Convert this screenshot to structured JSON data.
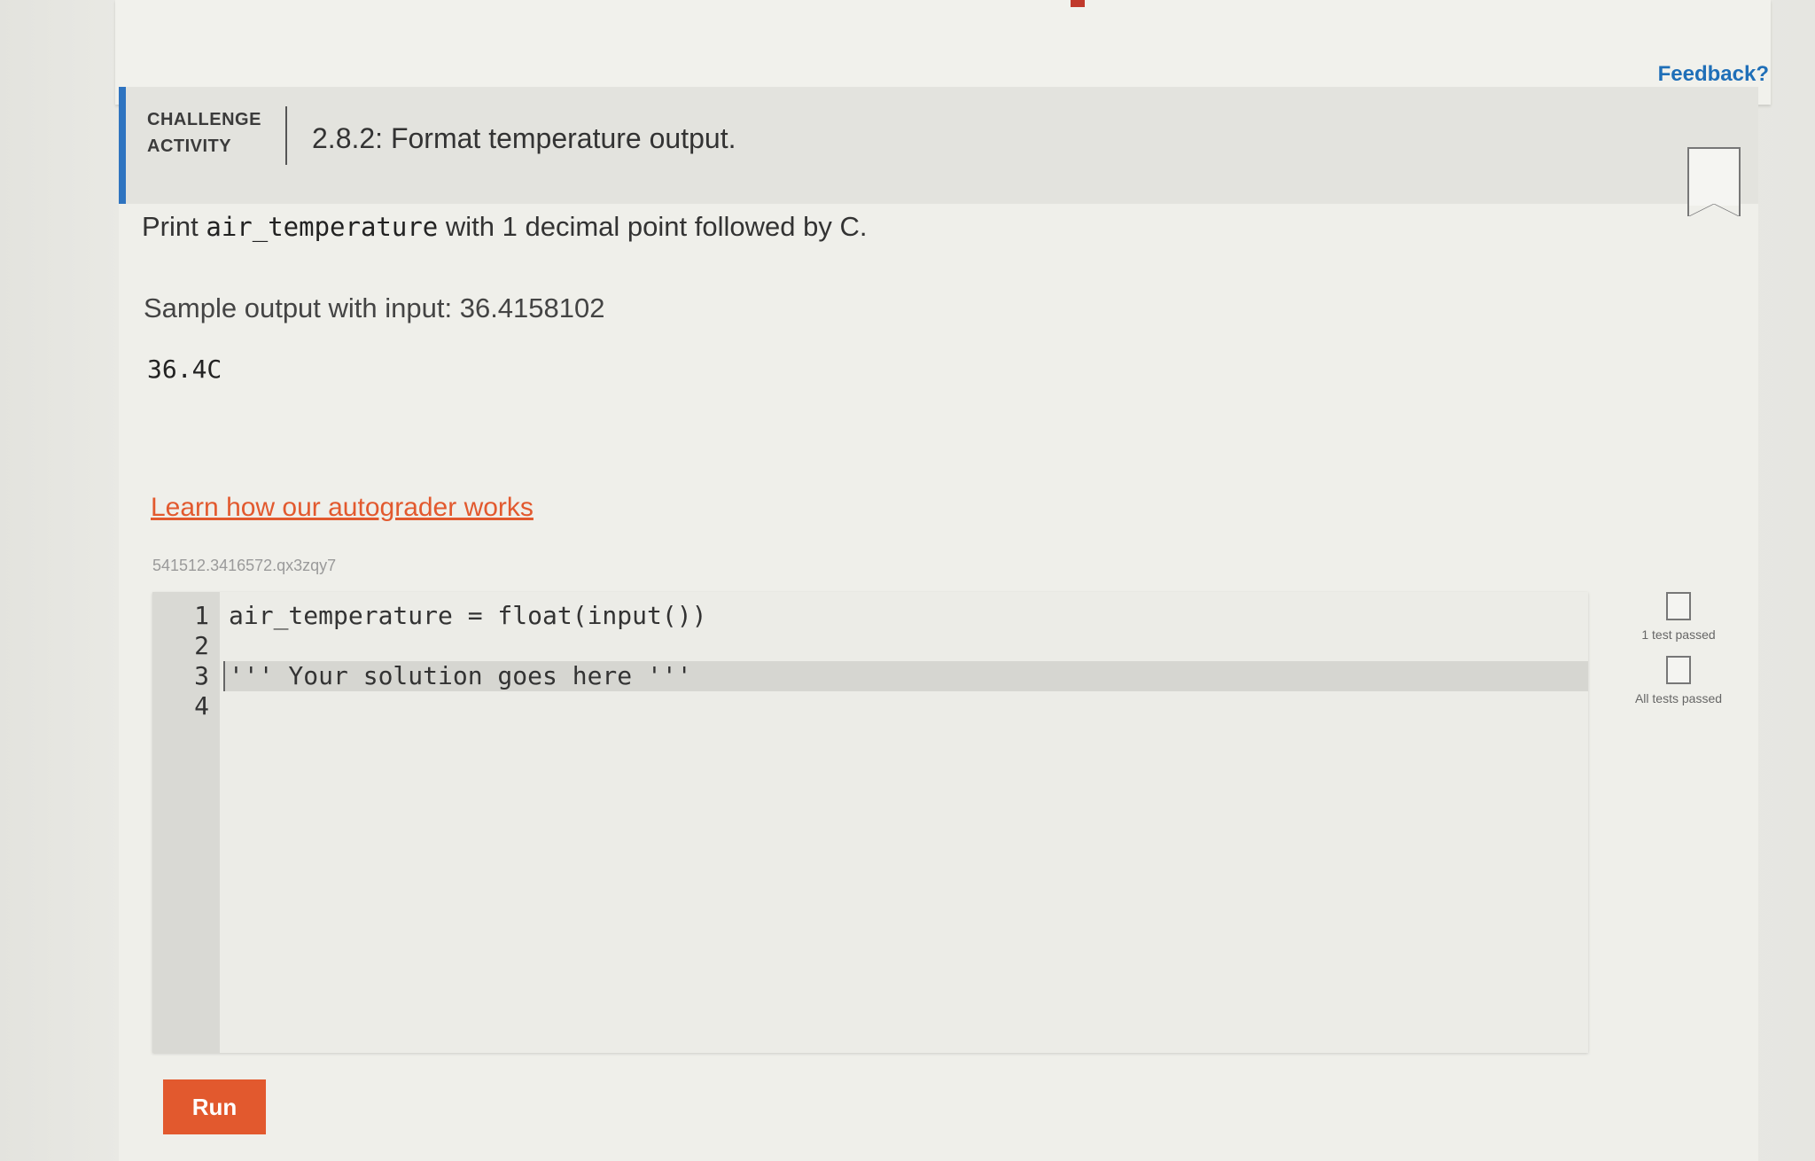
{
  "feedback_link": "Feedback?",
  "activity": {
    "type_label_line1": "CHALLENGE",
    "type_label_line2": "ACTIVITY",
    "title": "2.8.2: Format temperature output."
  },
  "instructions": {
    "prefix": "Print ",
    "variable": "air_temperature",
    "suffix": " with 1 decimal point followed by C."
  },
  "sample": {
    "label": "Sample output with input: 36.4158102",
    "output": "36.4C"
  },
  "autograder_link": "Learn how our autograder works",
  "code_id": "541512.3416572.qx3zqy7",
  "editor": {
    "line_numbers": [
      "1",
      "2",
      "3",
      "4"
    ],
    "lines": [
      "air_temperature = float(input())",
      "",
      "''' Your solution goes here '''",
      ""
    ],
    "active_line": 3
  },
  "tests": {
    "one_test": "1 test passed",
    "all_tests": "All tests passed"
  },
  "run_button": "Run",
  "colors": {
    "accent_orange": "#e2592e",
    "accent_blue": "#2f74c0",
    "link_blue": "#1f6fb8"
  }
}
